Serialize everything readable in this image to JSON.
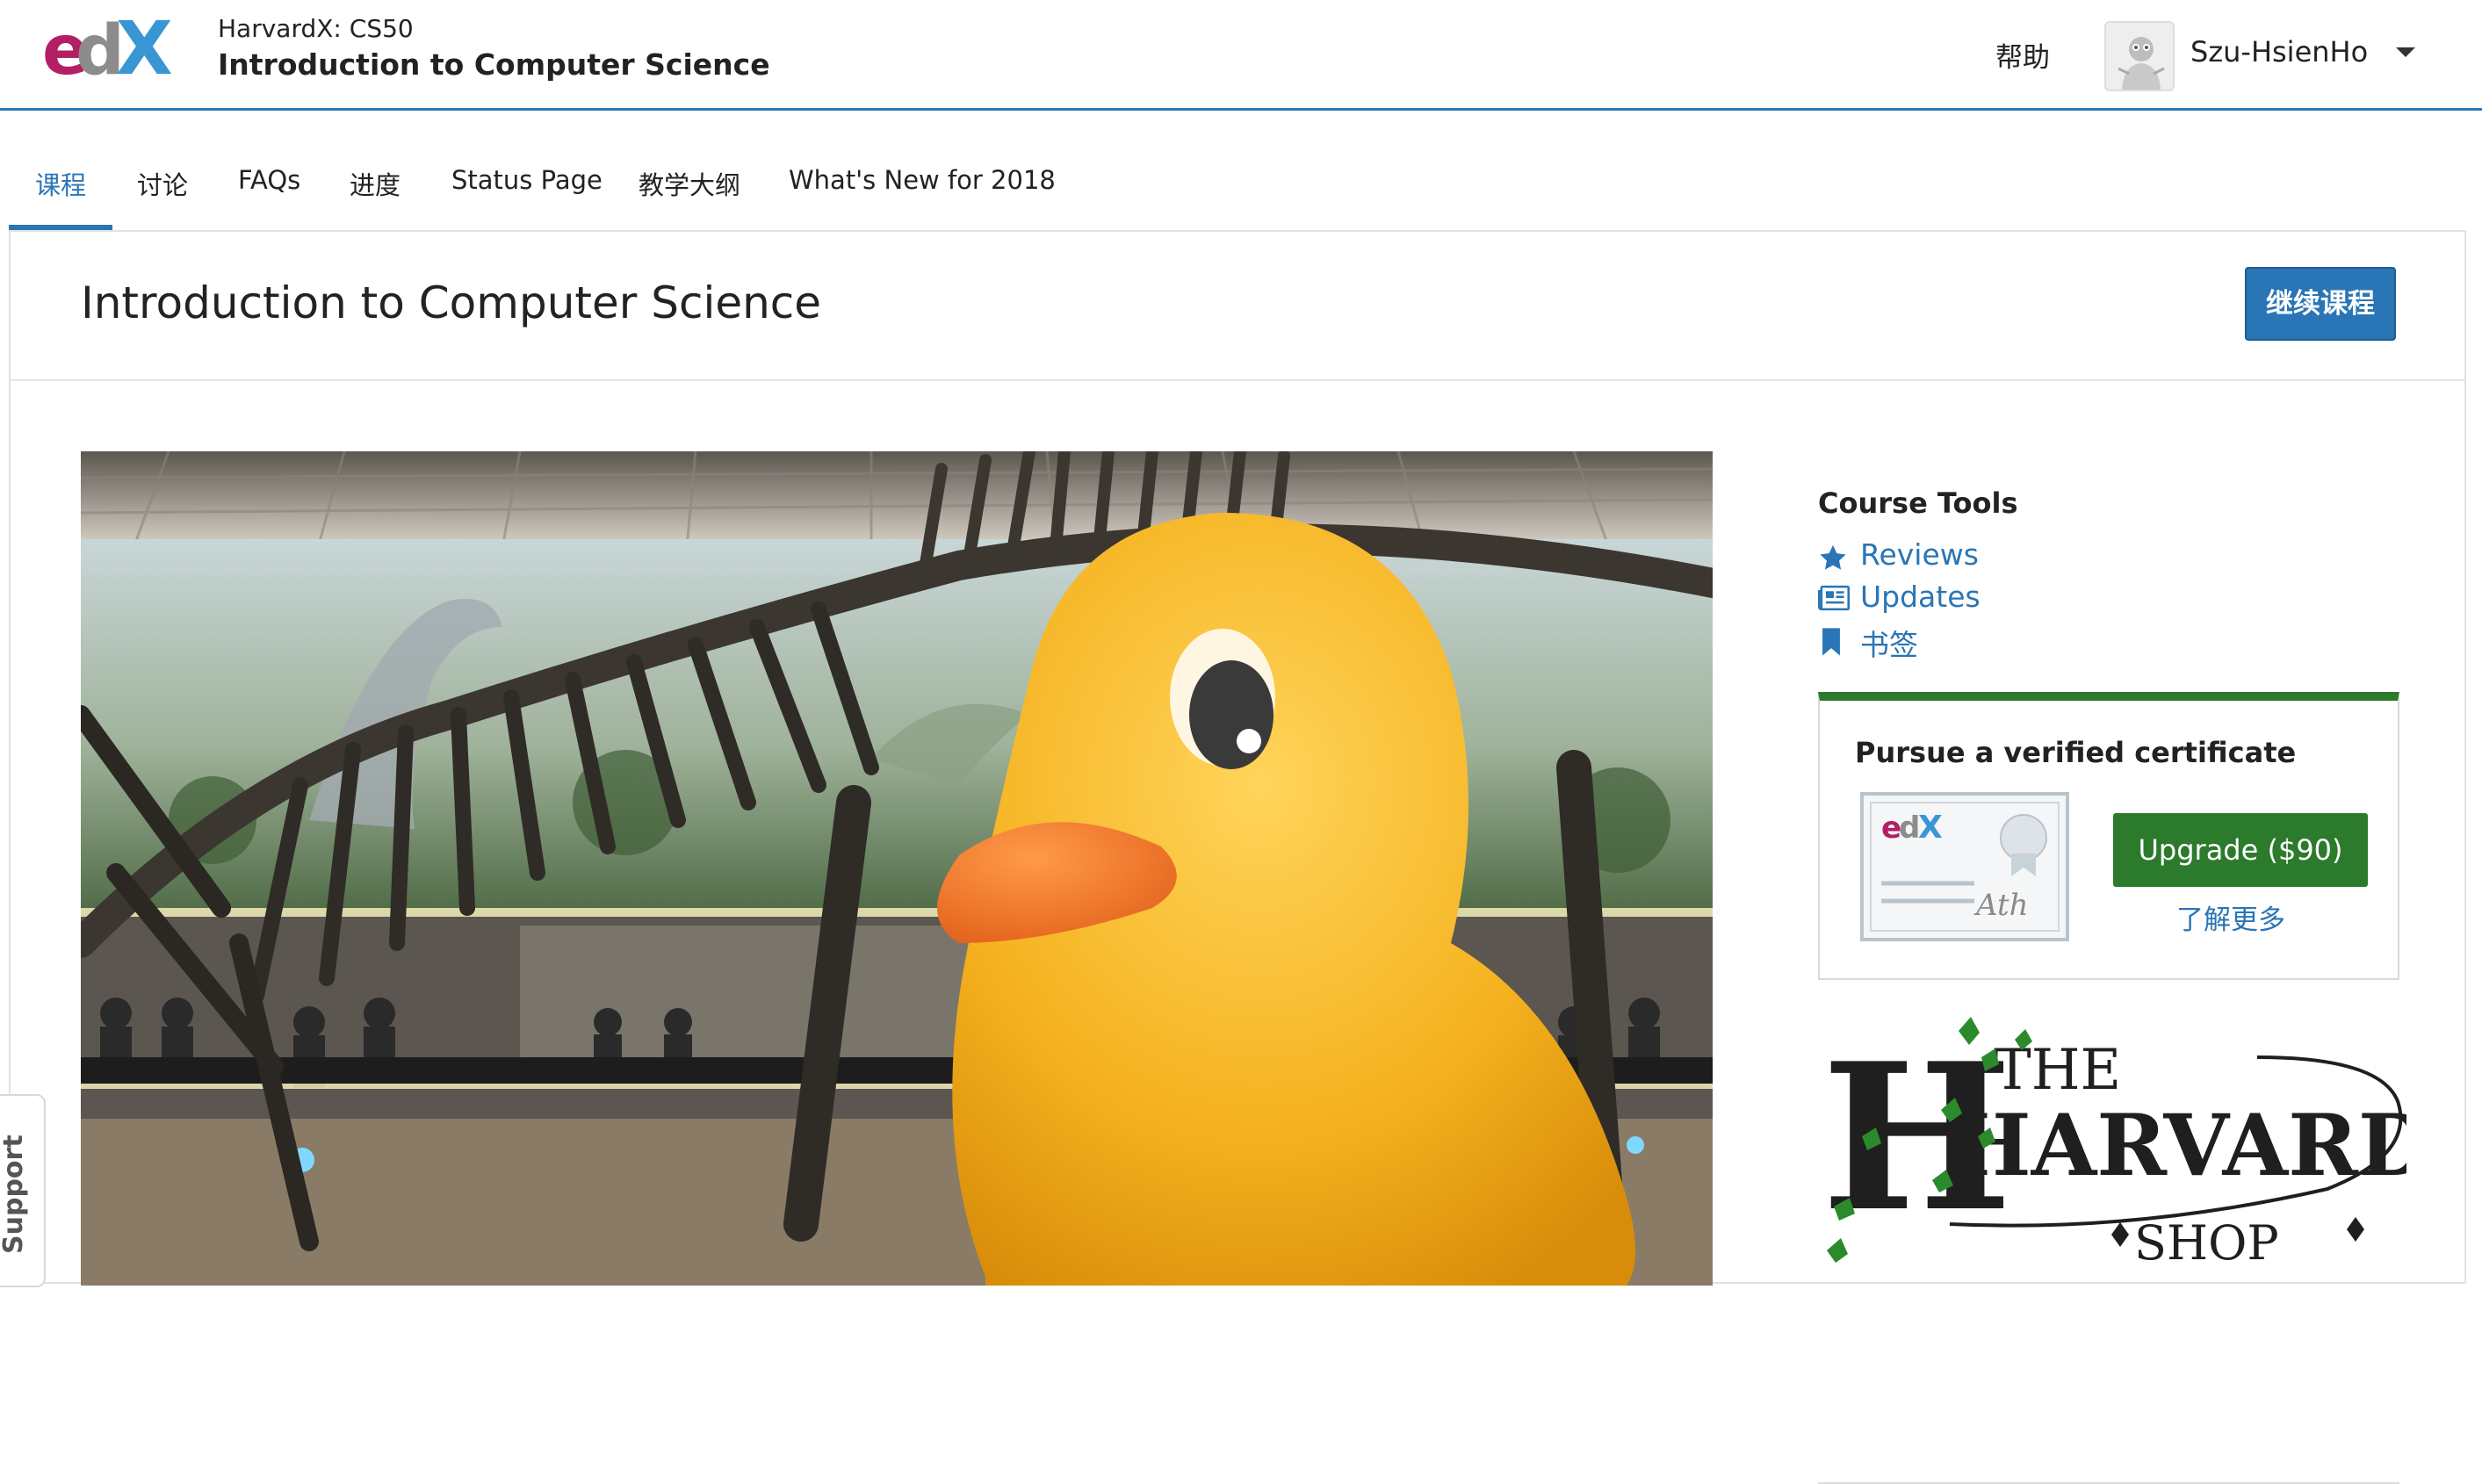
{
  "header": {
    "logo_text": "edX",
    "course_org": "HarvardX: CS50",
    "course_name": "Introduction to Computer Science",
    "help_label": "帮助",
    "username": "Szu-HsienHo"
  },
  "tabs": [
    {
      "label": "课程",
      "active": true
    },
    {
      "label": "讨论",
      "active": false
    },
    {
      "label": "FAQs",
      "active": false
    },
    {
      "label": "进度",
      "active": false
    },
    {
      "label": "Status Page",
      "active": false
    },
    {
      "label": "教学大纲",
      "active": false
    },
    {
      "label": "What's New for 2018",
      "active": false
    }
  ],
  "main": {
    "title": "Introduction to Computer Science",
    "resume_button": "继续课程",
    "hero_image": "giant yellow rubber duck beside dinosaur skeletons in a museum hall"
  },
  "sidebar": {
    "tools_title": "Course Tools",
    "tools": [
      {
        "label": "Reviews",
        "icon": "star-icon"
      },
      {
        "label": "Updates",
        "icon": "newspaper-icon"
      },
      {
        "label": "书签",
        "icon": "bookmark-icon"
      }
    ],
    "upgrade": {
      "title": "Pursue a verified certificate",
      "button": "Upgrade ($90)",
      "learn_more": "了解更多",
      "cert_logo": "edX",
      "cert_signature": "Ath"
    },
    "shop": {
      "line1": "THE",
      "line2": "HARVARD",
      "line3": "SHOP"
    }
  },
  "support_tab": "Support",
  "colors": {
    "accent": "#2a75b5",
    "upgrade_green": "#2c7a2c",
    "edx_magenta": "#b31f64",
    "edx_blue": "#3896d4"
  }
}
